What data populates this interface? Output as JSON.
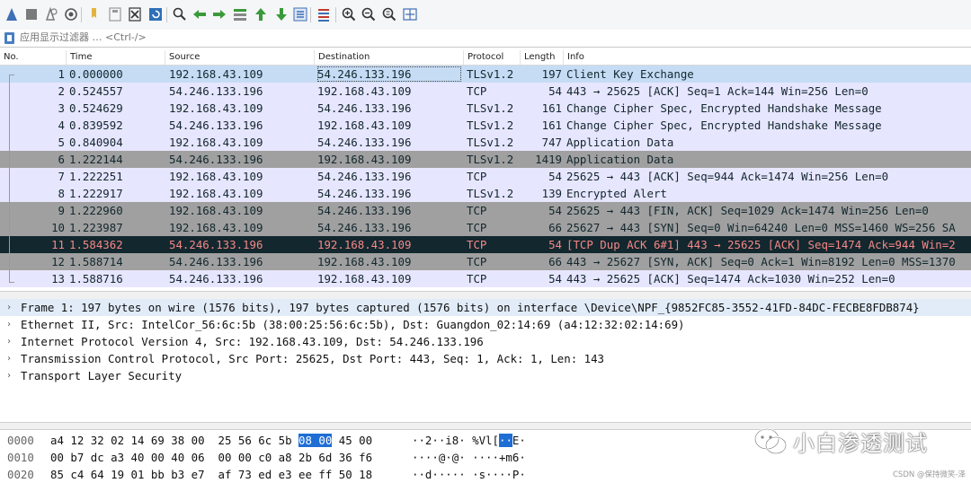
{
  "toolbar": {
    "buttons": [
      {
        "name": "start-capture-icon",
        "color": "#3f6fb5"
      },
      {
        "name": "stop-capture-icon",
        "color": "#7a7a7a"
      },
      {
        "name": "restart-capture-icon",
        "color": "#7a7a7a"
      },
      {
        "name": "capture-options-icon",
        "color": "#555555"
      },
      {
        "name": "open-file-icon",
        "color": "#e3b341"
      },
      {
        "name": "save-file-icon",
        "color": "#9a9a9a"
      },
      {
        "name": "close-file-icon",
        "color": "#333333"
      },
      {
        "name": "reload-file-icon",
        "color": "#2d6fb8"
      },
      {
        "name": "find-packet-icon",
        "color": "#333333"
      },
      {
        "name": "go-back-icon",
        "color": "#3a9a3a"
      },
      {
        "name": "go-forward-icon",
        "color": "#3a9a3a"
      },
      {
        "name": "go-to-packet-icon",
        "color": "#3a9a3a"
      },
      {
        "name": "go-first-packet-icon",
        "color": "#3a9a3a"
      },
      {
        "name": "go-last-packet-icon",
        "color": "#3a9a3a"
      },
      {
        "name": "auto-scroll-icon",
        "color": "#3f6fb5"
      },
      {
        "name": "colorize-icon",
        "color": "#c0392b"
      },
      {
        "name": "zoom-in-icon",
        "color": "#333333"
      },
      {
        "name": "zoom-out-icon",
        "color": "#333333"
      },
      {
        "name": "normal-size-icon",
        "color": "#333333"
      },
      {
        "name": "resize-columns-icon",
        "color": "#3f6fb5"
      }
    ]
  },
  "filter": {
    "placeholder": "应用显示过滤器 … <Ctrl-/>"
  },
  "packet_list": {
    "columns": [
      "No.",
      "Time",
      "Source",
      "Destination",
      "Protocol",
      "Length",
      "Info"
    ],
    "rows": [
      {
        "no": "1",
        "time": "0.000000",
        "src": "192.168.43.109",
        "dst": "54.246.133.196",
        "proto": "TLSv1.2",
        "len": "197",
        "info": "Client Key Exchange",
        "bg": "#c6dcf5",
        "fg": "#12272e",
        "selected": true
      },
      {
        "no": "2",
        "time": "0.524557",
        "src": "54.246.133.196",
        "dst": "192.168.43.109",
        "proto": "TCP",
        "len": "54",
        "info": "443 → 25625 [ACK] Seq=1 Ack=144 Win=256 Len=0",
        "bg": "#e7e6ff",
        "fg": "#12272e"
      },
      {
        "no": "3",
        "time": "0.524629",
        "src": "192.168.43.109",
        "dst": "54.246.133.196",
        "proto": "TLSv1.2",
        "len": "161",
        "info": "Change Cipher Spec, Encrypted Handshake Message",
        "bg": "#e7e6ff",
        "fg": "#12272e"
      },
      {
        "no": "4",
        "time": "0.839592",
        "src": "54.246.133.196",
        "dst": "192.168.43.109",
        "proto": "TLSv1.2",
        "len": "161",
        "info": "Change Cipher Spec, Encrypted Handshake Message",
        "bg": "#e7e6ff",
        "fg": "#12272e"
      },
      {
        "no": "5",
        "time": "0.840904",
        "src": "192.168.43.109",
        "dst": "54.246.133.196",
        "proto": "TLSv1.2",
        "len": "747",
        "info": "Application Data",
        "bg": "#e7e6ff",
        "fg": "#12272e"
      },
      {
        "no": "6",
        "time": "1.222144",
        "src": "54.246.133.196",
        "dst": "192.168.43.109",
        "proto": "TLSv1.2",
        "len": "1419",
        "info": "Application Data",
        "bg": "#a0a0a0",
        "fg": "#12272e"
      },
      {
        "no": "7",
        "time": "1.222251",
        "src": "192.168.43.109",
        "dst": "54.246.133.196",
        "proto": "TCP",
        "len": "54",
        "info": "25625 → 443 [ACK] Seq=944 Ack=1474 Win=256 Len=0",
        "bg": "#e7e6ff",
        "fg": "#12272e"
      },
      {
        "no": "8",
        "time": "1.222917",
        "src": "192.168.43.109",
        "dst": "54.246.133.196",
        "proto": "TLSv1.2",
        "len": "139",
        "info": "Encrypted Alert",
        "bg": "#e7e6ff",
        "fg": "#12272e"
      },
      {
        "no": "9",
        "time": "1.222960",
        "src": "192.168.43.109",
        "dst": "54.246.133.196",
        "proto": "TCP",
        "len": "54",
        "info": "25625 → 443 [FIN, ACK] Seq=1029 Ack=1474 Win=256 Len=0",
        "bg": "#a0a0a0",
        "fg": "#12272e"
      },
      {
        "no": "10",
        "time": "1.223987",
        "src": "192.168.43.109",
        "dst": "54.246.133.196",
        "proto": "TCP",
        "len": "66",
        "info": "25627 → 443 [SYN] Seq=0 Win=64240 Len=0 MSS=1460 WS=256 SA",
        "bg": "#a0a0a0",
        "fg": "#12272e"
      },
      {
        "no": "11",
        "time": "1.584362",
        "src": "54.246.133.196",
        "dst": "192.168.43.109",
        "proto": "TCP",
        "len": "54",
        "info": "[TCP Dup ACK 6#1] 443 → 25625 [ACK] Seq=1474 Ack=944 Win=2",
        "bg": "#12272e",
        "fg": "#f78787"
      },
      {
        "no": "12",
        "time": "1.588714",
        "src": "54.246.133.196",
        "dst": "192.168.43.109",
        "proto": "TCP",
        "len": "66",
        "info": "443 → 25627 [SYN, ACK] Seq=0 Ack=1 Win=8192 Len=0 MSS=1370",
        "bg": "#a0a0a0",
        "fg": "#12272e"
      },
      {
        "no": "13",
        "time": "1.588716",
        "src": "54.246.133.196",
        "dst": "192.168.43.109",
        "proto": "TCP",
        "len": "54",
        "info": "443 → 25625 [ACK] Seq=1474 Ack=1030 Win=252 Len=0",
        "bg": "#e7e6ff",
        "fg": "#12272e"
      }
    ]
  },
  "details": [
    {
      "text": "Frame 1: 197 bytes on wire (1576 bits), 197 bytes captured (1576 bits) on interface \\Device\\NPF_{9852FC85-3552-41FD-84DC-FECBE8FDB874}",
      "highlighted": true
    },
    {
      "text": "Ethernet II, Src: IntelCor_56:6c:5b (38:00:25:56:6c:5b), Dst: Guangdon_02:14:69 (a4:12:32:02:14:69)",
      "highlighted": false
    },
    {
      "text": "Internet Protocol Version 4, Src: 192.168.43.109, Dst: 54.246.133.196",
      "highlighted": false
    },
    {
      "text": "Transmission Control Protocol, Src Port: 25625, Dst Port: 443, Seq: 1, Ack: 1, Len: 143",
      "highlighted": false
    },
    {
      "text": "Transport Layer Security",
      "highlighted": false
    }
  ],
  "bytes": [
    {
      "offset": "0000",
      "hex_pre": "a4 12 32 02 14 69 38 00  25 56 6c 5b ",
      "hex_sel": "08 00",
      "hex_post": " 45 00",
      "ascii_pre": "··2··i8· %Vl[",
      "ascii_sel": "··",
      "ascii_post": "E·"
    },
    {
      "offset": "0010",
      "hex_pre": "00 b7 dc a3 40 00 40 06  00 00 c0 a8 2b 6d 36 f6",
      "hex_sel": "",
      "hex_post": "",
      "ascii_pre": "····@·@· ····+m6·",
      "ascii_sel": "",
      "ascii_post": ""
    },
    {
      "offset": "0020",
      "hex_pre": "85 c4 64 19 01 bb b3 e7  af 73 ed e3 ee ff 50 18",
      "hex_sel": "",
      "hex_post": "",
      "ascii_pre": "··d····· ·s····P·",
      "ascii_sel": "",
      "ascii_post": ""
    }
  ],
  "watermark": {
    "text": "小白渗透测试",
    "credit": "CSDN @保持微笑-泽"
  }
}
